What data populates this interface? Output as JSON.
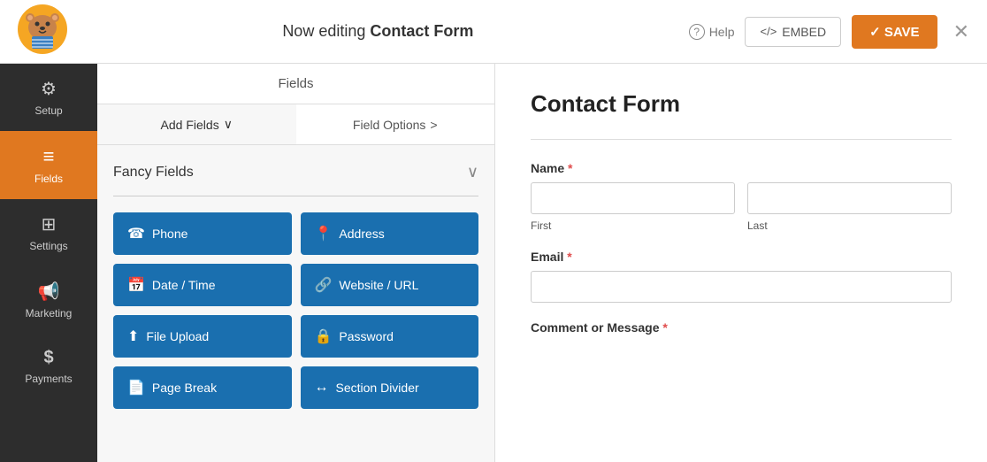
{
  "topbar": {
    "title_prefix": "Now editing ",
    "title_bold": "Contact Form",
    "help_label": "Help",
    "embed_label": "EMBED",
    "save_label": "✓ SAVE",
    "close_label": "✕"
  },
  "sidebar": {
    "items": [
      {
        "id": "setup",
        "label": "Setup",
        "icon": "⚙",
        "active": false
      },
      {
        "id": "fields",
        "label": "Fields",
        "icon": "☰",
        "active": true
      },
      {
        "id": "settings",
        "label": "Settings",
        "icon": "⊞",
        "active": false
      },
      {
        "id": "marketing",
        "label": "Marketing",
        "icon": "📢",
        "active": false
      },
      {
        "id": "payments",
        "label": "Payments",
        "icon": "$",
        "active": false
      }
    ]
  },
  "fields_panel": {
    "header": "Fields",
    "tabs": [
      {
        "id": "add-fields",
        "label": "Add Fields",
        "icon": "∨",
        "active": true
      },
      {
        "id": "field-options",
        "label": "Field Options",
        "icon": ">",
        "active": false
      }
    ],
    "fancy_fields_label": "Fancy Fields",
    "buttons": [
      {
        "id": "phone",
        "label": "Phone",
        "icon": "☎"
      },
      {
        "id": "address",
        "label": "Address",
        "icon": "📍"
      },
      {
        "id": "datetime",
        "label": "Date / Time",
        "icon": "📅"
      },
      {
        "id": "website",
        "label": "Website / URL",
        "icon": "🔗"
      },
      {
        "id": "file-upload",
        "label": "File Upload",
        "icon": "⬆"
      },
      {
        "id": "password",
        "label": "Password",
        "icon": "🔒"
      },
      {
        "id": "page-break",
        "label": "Page Break",
        "icon": "📄"
      },
      {
        "id": "section-divider",
        "label": "Section Divider",
        "icon": "↔"
      }
    ]
  },
  "form_preview": {
    "title": "Contact Form",
    "name_label": "Name",
    "name_first": "First",
    "name_last": "Last",
    "email_label": "Email",
    "comment_label": "Comment or Message"
  }
}
